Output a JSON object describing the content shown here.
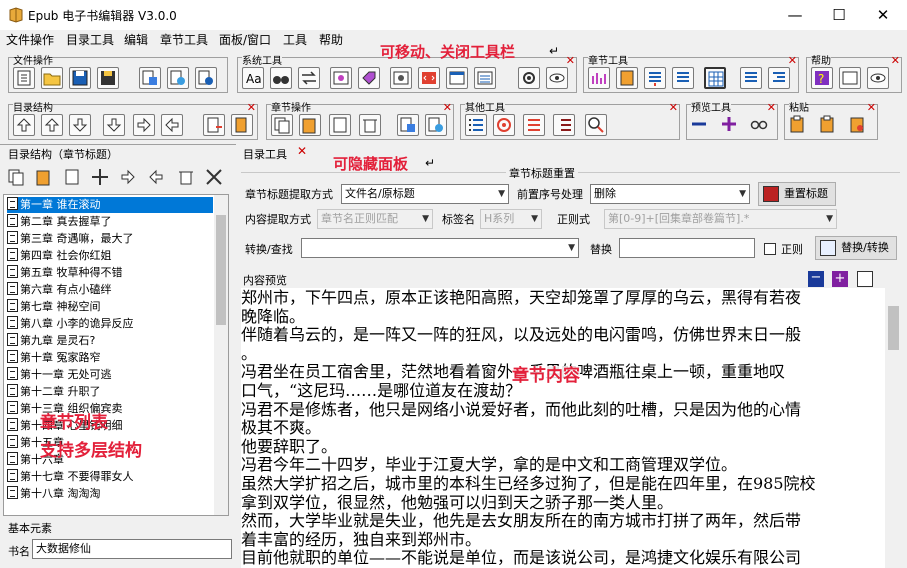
{
  "window": {
    "title": "Epub 电子书编辑器 V3.0.0",
    "minimize": "—",
    "maximize": "☐",
    "close": "✕"
  },
  "menu": [
    "文件操作",
    "目录工具",
    "编辑",
    "章节工具",
    "面板/窗口",
    "工具",
    "帮助"
  ],
  "toolbars": {
    "file": "文件操作",
    "system": "系统工具",
    "chapter_tools": "章节工具",
    "help": "帮助",
    "toc_ops": "目录结构",
    "chapter_ops": "章节操作",
    "other": "其他工具",
    "preview": "预览工具",
    "paste": "粘贴"
  },
  "annotations": {
    "movable": "可移动、关闭工具栏",
    "hideable": "可隐藏面板",
    "chapter_list": "章节列表",
    "multi_level": "支持多层结构",
    "chapter_content": "章节内容"
  },
  "left": {
    "title": "目录结构（章节标题）",
    "chapters": [
      "第一章 谁在滚动",
      "第二章 真去握草了",
      "第三章 奇遇嘛，最大了",
      "第四章 社会你红姐",
      "第五章 牧草种得不错",
      "第六章 有点小磕绊",
      "第七章 神秘空间",
      "第八章 小李的诡异反应",
      "第九章 是灵石?",
      "第十章 冤家路窄",
      "第十一章 无处可逃",
      "第十二章 升职了",
      "第十三章 组织偏宾卖",
      "第十四章 心里钱明细",
      "第十五章",
      "第十六章",
      "第十七章 不要得罪女人",
      "第十八章 淘淘淘"
    ],
    "basic_title": "基本元素",
    "book_label": "书名",
    "book_value": "大数据修仙"
  },
  "right": {
    "panel_title": "目录工具",
    "reset_group": "章节标题重置",
    "title_source_label": "章节标题提取方式",
    "title_source_value": "文件名/原标题",
    "prefix_label": "前置序号处理",
    "prefix_value": "删除",
    "reset_button": "重置标题",
    "content_label": "内容提取方式",
    "content_value": "章节名正则匹配",
    "tag_label": "标签名",
    "tag_value": "H系列",
    "regex_label": "正则式",
    "regex_value": "第[0-9]+[回集章部卷篇节].*",
    "find_label": "转换/查找",
    "replace_label": "替换",
    "regex_check": "正则",
    "replace_button": "替换/转换",
    "preview_title": "内容预览"
  },
  "content_lines": [
    "郑州市，下午四点，原本正该艳阳高照，天空却笼罩了厚厚的乌云，黑得有若夜",
    "晚降临。",
    "伴随着乌云的，是一阵又一阵的狂风，以及远处的电闪雷鸣，仿佛世界末日一般",
    "。",
    "冯君坐在员工宿舍里，茫然地看着窗外，手里的啤酒瓶往桌上一顿，重重地叹",
    "口气，“这尼玛……是哪位道友在渡劫？",
    "冯君不是修炼者，他只是网络小说爱好者，而他此刻的吐槽，只是因为他的心情",
    "极其不爽。",
    "他要辞职了。",
    "冯君今年二十四岁，毕业于江夏大学，拿的是中文和工商管理双学位。",
    "虽然大学扩招之后，城市里的本科生已经多过狗了，但是能在四年里，在985院校",
    "拿到双学位，很显然，他勉强可以归到天之骄子那一类人里。",
    "然而，大学毕业就是失业，他先是去女朋友所在的南方城市打拼了两年，然后带",
    "着丰富的经历，独自来到郑州市。",
    "目前他就职的单位——不能说是单位，而是该说公司，是鸿捷文化娱乐有限公司"
  ],
  "colors": {
    "selection": "#0078d7",
    "annotation": "#e3203a",
    "close_mark": "#cc0000"
  }
}
